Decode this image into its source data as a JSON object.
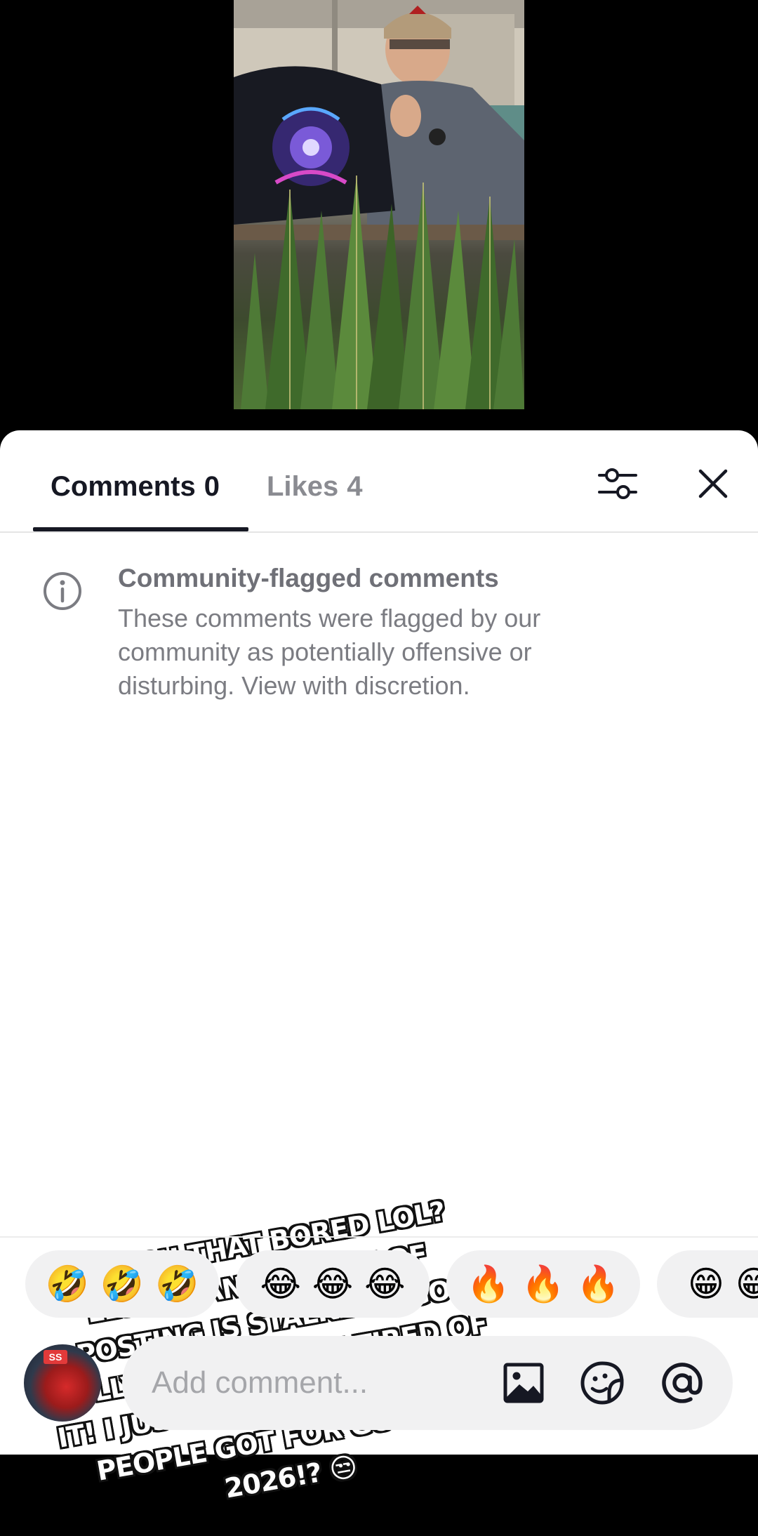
{
  "tabs": {
    "comments_label": "Comments",
    "comments_count": "0",
    "likes_label": "Likes",
    "likes_count": "4"
  },
  "notice": {
    "icon": "info-icon",
    "title": "Community-flagged comments",
    "body": "These comments were flagged by our community as potentially offensive or disturbing. View with discretion."
  },
  "sticker_text": "ARE YOU THAT BORED LOL? LESS THAN 5-10 MIN OF POSTING IS STALKING! GO BULLY YOURSELF I'M TIRED OF IT! I JUST WANNA KNOW WHAT PEOPLE GOT FOR GO FEST 2026!? 😒",
  "quick_reactions": [
    "🤣 🤣 🤣",
    "😂 😂 😂",
    "🔥 🔥 🔥",
    "😁 😁 😁"
  ],
  "comment_input": {
    "placeholder": "Add comment...",
    "avatar_badge": "SS"
  },
  "icons": [
    "filter-icon",
    "close-icon",
    "info-icon",
    "image-icon",
    "sticker-icon",
    "mention-icon"
  ]
}
